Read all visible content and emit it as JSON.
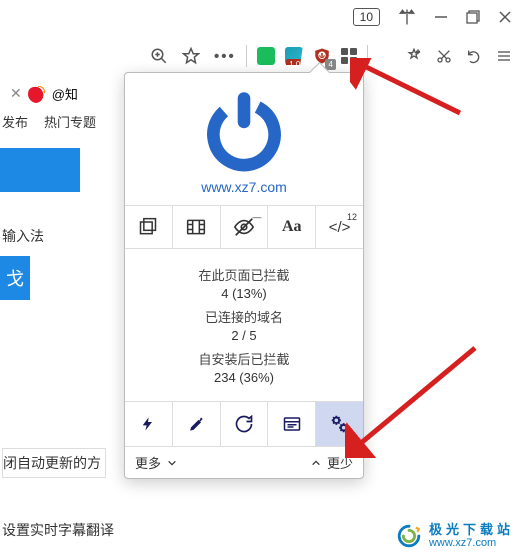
{
  "window": {
    "tab_count": "10"
  },
  "extensions": {
    "teal_badge": "1.00",
    "ublock_badge": "4"
  },
  "background": {
    "tab_label": "@知",
    "nav": [
      "发布",
      "热门专题"
    ],
    "text_input": "输入法",
    "blue_btn": "戈",
    "text_auto_update": "闭自动更新的方",
    "text_subtitles": "设置实时字幕翻译"
  },
  "popup": {
    "url": "www.xz7.com",
    "tools": {
      "code_badge": "12"
    },
    "stats": {
      "page_label": "在此页面已拦截",
      "page_value": "4 (13%)",
      "domains_label": "已连接的域名",
      "domains_value": "2 / 5",
      "install_label": "自安装后已拦截",
      "install_value": "234 (36%)"
    },
    "footer": {
      "more": "更多",
      "less": "更少"
    }
  },
  "watermark": {
    "cn": "极光下载站",
    "url": "www.xz7.com"
  }
}
